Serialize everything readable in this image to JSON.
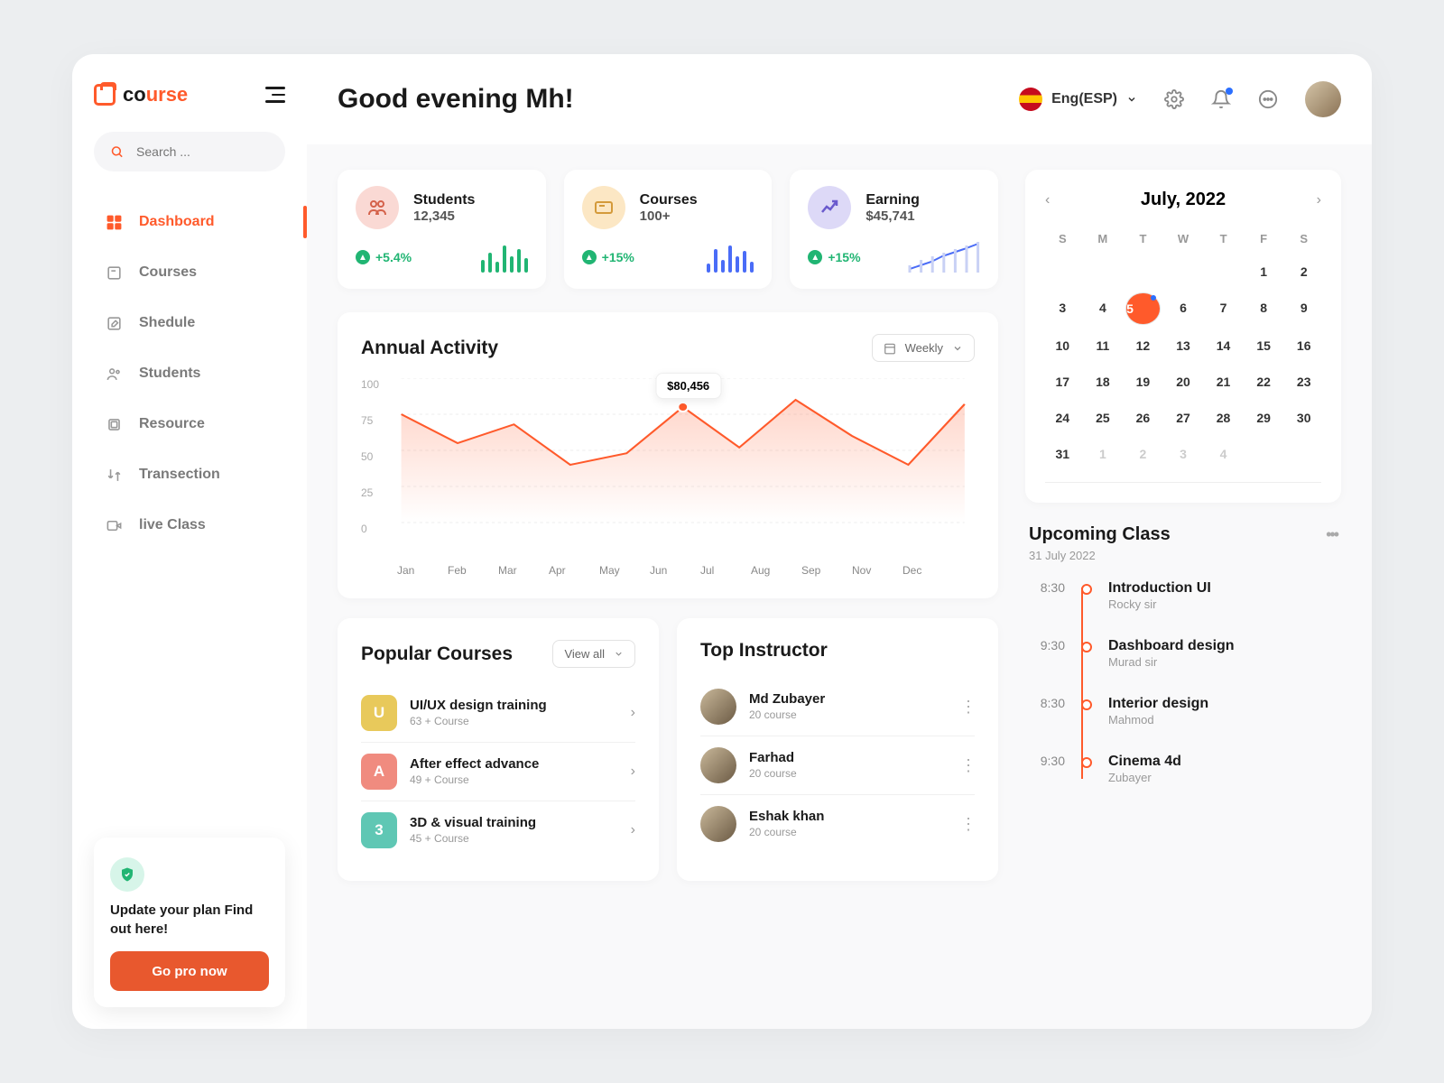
{
  "brand": {
    "p1": "co",
    "p2": "urse"
  },
  "search": {
    "placeholder": "Search ..."
  },
  "nav": [
    {
      "label": "Dashboard",
      "icon": "grid",
      "active": true
    },
    {
      "label": "Courses",
      "icon": "book"
    },
    {
      "label": "Shedule",
      "icon": "edit"
    },
    {
      "label": "Students",
      "icon": "users"
    },
    {
      "label": "Resource",
      "icon": "layers"
    },
    {
      "label": "Transection",
      "icon": "swap"
    },
    {
      "label": "live Class",
      "icon": "video"
    }
  ],
  "promo": {
    "line": "Update your plan Find out here!",
    "cta": "Go pro now"
  },
  "header": {
    "greeting": "Good evening Mh!",
    "lang": "Eng(ESP)"
  },
  "stats": [
    {
      "title": "Students",
      "value": "12,345",
      "pct": "+5.4%",
      "color": "pink",
      "bars": [
        14,
        22,
        12,
        30,
        18,
        26,
        16
      ],
      "barColor": "#21b573"
    },
    {
      "title": "Courses",
      "value": "100+",
      "pct": "+15%",
      "color": "yel",
      "bars": [
        10,
        26,
        14,
        30,
        18,
        24,
        12
      ],
      "barColor": "#4a6cf7"
    },
    {
      "title": "Earning",
      "value": "$45,741",
      "pct": "+15%",
      "color": "pur",
      "bars": [
        8,
        14,
        18,
        22,
        26,
        30,
        34
      ],
      "barColor": "#4a6cf7",
      "trend": true
    }
  ],
  "activity": {
    "title": "Annual Activity",
    "selector": "Weekly",
    "tooltip": "$80,456"
  },
  "chart_data": {
    "type": "area",
    "title": "Annual Activity",
    "xlabel": "",
    "ylabel": "",
    "ylim": [
      0,
      100
    ],
    "yticks": [
      0,
      25,
      50,
      75,
      100
    ],
    "categories": [
      "Jan",
      "Feb",
      "Mar",
      "Apr",
      "May",
      "Jun",
      "Jul",
      "Aug",
      "Sep",
      "Nov",
      "Dec"
    ],
    "values": [
      75,
      55,
      68,
      40,
      48,
      80,
      52,
      85,
      60,
      40,
      82
    ],
    "highlight": {
      "index": 5,
      "label": "$80,456"
    }
  },
  "popular": {
    "title": "Popular Courses",
    "viewall": "View all",
    "items": [
      {
        "badge": "U",
        "color": "#e8c95b",
        "name": "UI/UX design training",
        "sub": "63 + Course"
      },
      {
        "badge": "A",
        "color": "#f08b7f",
        "name": "After effect advance",
        "sub": "49 + Course"
      },
      {
        "badge": "3",
        "color": "#5fc7b4",
        "name": "3D & visual training",
        "sub": "45 + Course"
      }
    ]
  },
  "instructors": {
    "title": "Top Instructor",
    "items": [
      {
        "name": "Md Zubayer",
        "sub": "20 course"
      },
      {
        "name": "Farhad",
        "sub": "20 course"
      },
      {
        "name": "Eshak khan",
        "sub": "20 course"
      }
    ]
  },
  "calendar": {
    "title": "July, 2022",
    "dow": [
      "S",
      "M",
      "T",
      "W",
      "T",
      "F",
      "S"
    ],
    "weeks": [
      [
        null,
        null,
        null,
        null,
        null,
        1,
        2
      ],
      [
        3,
        4,
        5,
        6,
        7,
        8,
        9
      ],
      [
        10,
        11,
        12,
        13,
        14,
        15,
        16
      ],
      [
        17,
        18,
        19,
        20,
        21,
        22,
        23
      ],
      [
        24,
        25,
        26,
        27,
        28,
        29,
        30
      ],
      [
        31,
        1,
        2,
        3,
        4,
        null,
        null
      ]
    ],
    "days": [
      1,
      2,
      3,
      4,
      5,
      6,
      7,
      8,
      9,
      10,
      11,
      12,
      13,
      14,
      15,
      16,
      17,
      18,
      19,
      20,
      21,
      22,
      23,
      24,
      25,
      26,
      27,
      28,
      29,
      30,
      31
    ],
    "next": [
      1,
      2,
      3,
      4
    ],
    "selected": 5
  },
  "upcoming": {
    "title": "Upcoming Class",
    "date": "31 July 2022",
    "items": [
      {
        "time": "8:30",
        "title": "Introduction UI",
        "by": "Rocky sir"
      },
      {
        "time": "9:30",
        "title": "Dashboard design",
        "by": "Murad sir"
      },
      {
        "time": "8:30",
        "title": "Interior design",
        "by": "Mahmod"
      },
      {
        "time": "9:30",
        "title": "Cinema 4d",
        "by": "Zubayer"
      }
    ]
  }
}
